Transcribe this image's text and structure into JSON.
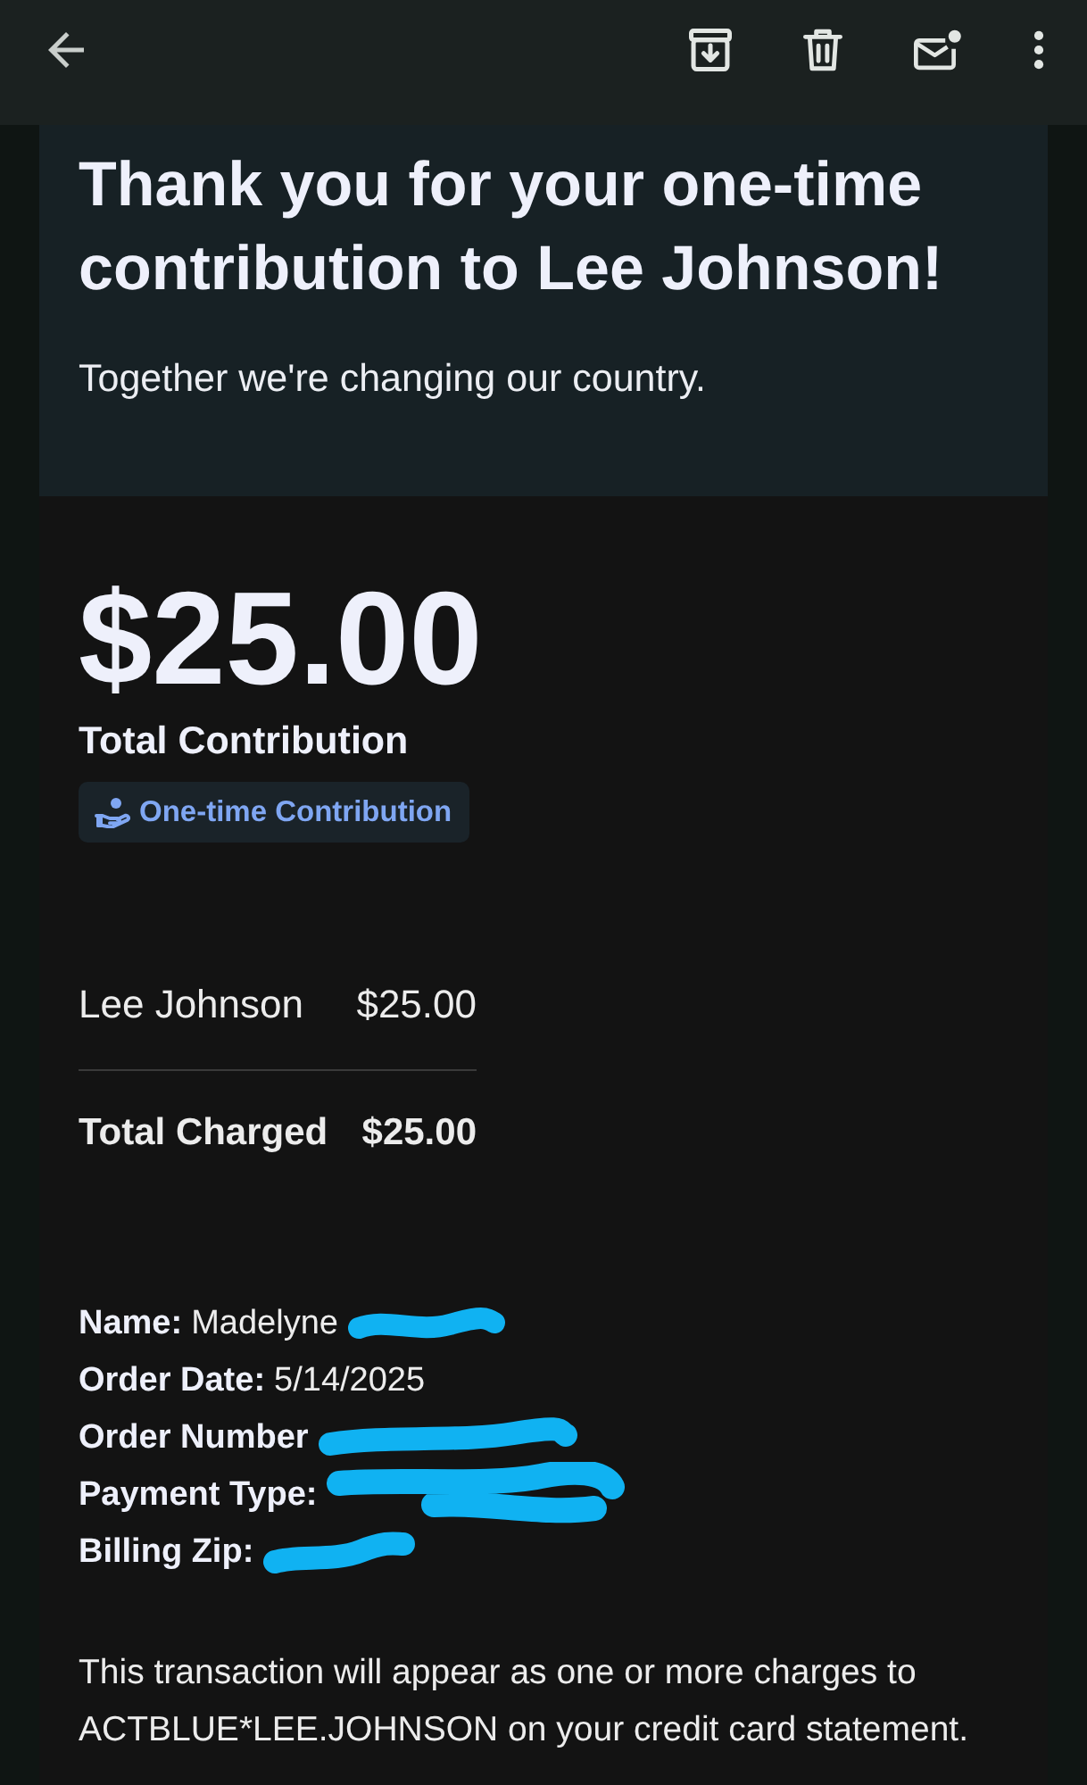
{
  "header": {
    "title": "Thank you for your one-time contribution to Lee Johnson!",
    "subtitle": "Together we're changing our country."
  },
  "summary": {
    "amount": "$25.00",
    "amount_label": "Total Contribution",
    "badge": "One-time Contribution"
  },
  "line_items": [
    {
      "name": "Lee Johnson",
      "amount": "$25.00"
    }
  ],
  "total": {
    "label": "Total Charged",
    "amount": "$25.00"
  },
  "details": [
    {
      "label": "Name:",
      "value": "Madelyne",
      "redacted": true
    },
    {
      "label": "Order Date:",
      "value": "5/14/2025",
      "redacted": false
    },
    {
      "label": "Order Number",
      "redacted": true
    },
    {
      "label": "Payment Type:",
      "redacted": true
    },
    {
      "label": "Billing Zip:",
      "redacted": true
    }
  ],
  "footer_note": "This transaction will appear as one or more charges to ACTBLUE*LEE.JOHNSON on your credit card statement."
}
